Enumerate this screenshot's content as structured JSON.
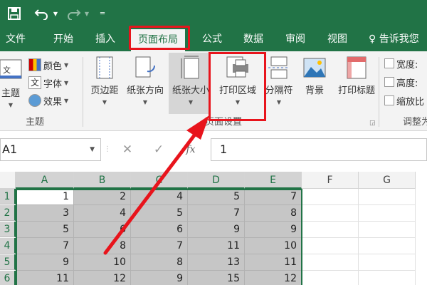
{
  "quick_access": {
    "save_icon": "save-icon",
    "undo_icon": "undo-icon",
    "redo_icon": "redo-icon",
    "customize_icon": "customize-qat-icon"
  },
  "tabs": [
    {
      "label": "文件",
      "active": false
    },
    {
      "label": "开始",
      "active": false
    },
    {
      "label": "插入",
      "active": false
    },
    {
      "label": "页面布局",
      "active": true
    },
    {
      "label": "公式",
      "active": false
    },
    {
      "label": "数据",
      "active": false
    },
    {
      "label": "审阅",
      "active": false
    },
    {
      "label": "视图",
      "active": false
    }
  ],
  "tell_me": {
    "label": "告诉我您",
    "icon": "lightbulb-icon"
  },
  "ribbon": {
    "themes": {
      "theme_label": "主题",
      "colors_label": "颜色",
      "fonts_label": "字体",
      "effects_label": "效果",
      "group_label": "主题",
      "fonts_glyph": "文"
    },
    "page_setup": {
      "margins_label": "页边距",
      "orientation_label": "纸张方向",
      "size_label": "纸张大小",
      "print_area_label": "打印区域",
      "breaks_label": "分隔符",
      "background_label": "背景",
      "print_titles_label": "打印标题",
      "group_label": "页面设置"
    },
    "scale": {
      "width_label": "宽度:",
      "height_label": "高度:",
      "scale_label": "缩放比",
      "group_label": "调整为"
    }
  },
  "formula_bar": {
    "name_box": "A1",
    "cancel": "✕",
    "enter": "✓",
    "fx": "fx",
    "content": "1"
  },
  "grid": {
    "columns": [
      "A",
      "B",
      "C",
      "D",
      "E",
      "F",
      "G"
    ],
    "rows": [
      "1",
      "2",
      "3",
      "4",
      "5",
      "6"
    ],
    "data": [
      [
        "1",
        "2",
        "4",
        "5",
        "7"
      ],
      [
        "3",
        "4",
        "5",
        "7",
        "8"
      ],
      [
        "5",
        "6",
        "6",
        "9",
        "9"
      ],
      [
        "7",
        "8",
        "7",
        "11",
        "10"
      ],
      [
        "9",
        "10",
        "8",
        "13",
        "11"
      ],
      [
        "11",
        "12",
        "9",
        "15",
        "12"
      ]
    ]
  },
  "colors": {
    "excel_green": "#217346",
    "highlight_red": "#e8141c",
    "selection_gray": "#c6c6c6"
  }
}
